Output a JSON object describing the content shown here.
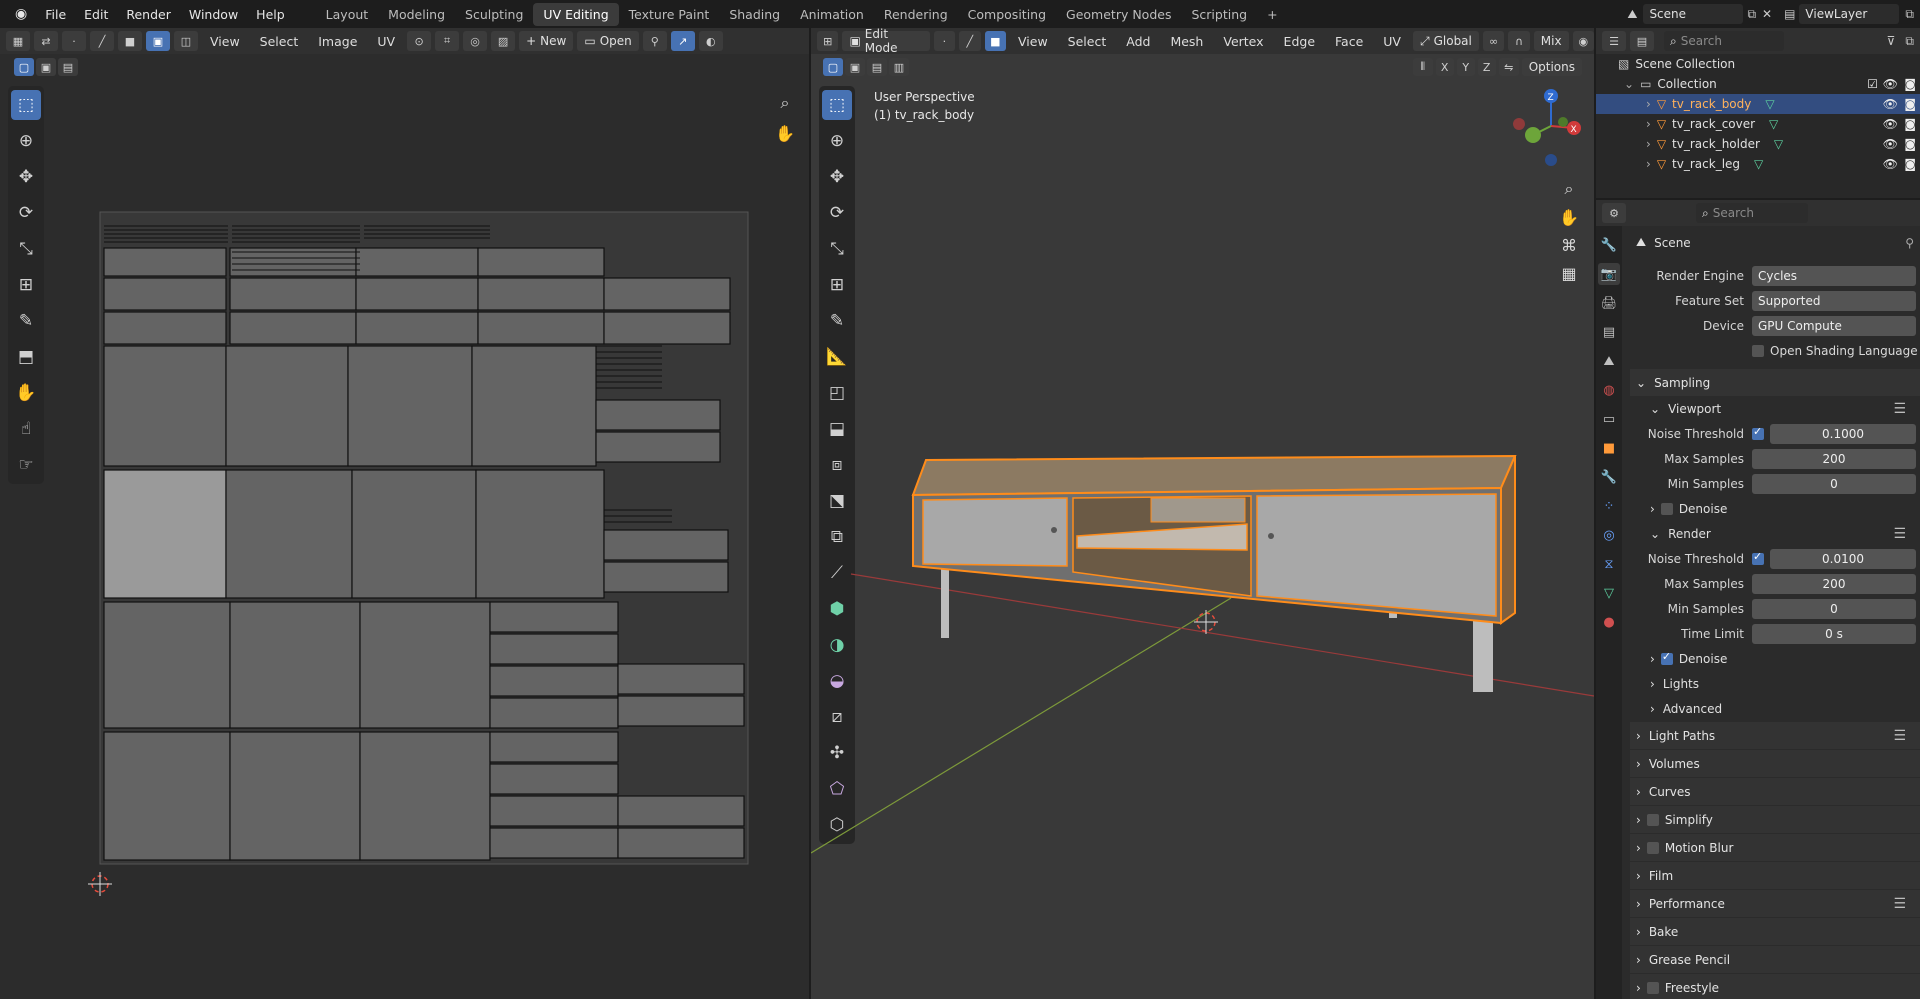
{
  "menu": [
    "File",
    "Edit",
    "Render",
    "Window",
    "Help"
  ],
  "workspaces": [
    "Layout",
    "Modeling",
    "Sculpting",
    "UV Editing",
    "Texture Paint",
    "Shading",
    "Animation",
    "Rendering",
    "Compositing",
    "Geometry Nodes",
    "Scripting"
  ],
  "active_workspace": "UV Editing",
  "scene_name": "Scene",
  "view_layer": "ViewLayer",
  "uv_editor": {
    "menus": [
      "View",
      "Select",
      "Image",
      "UV"
    ],
    "new_label": "New",
    "open_label": "Open"
  },
  "viewport": {
    "mode": "Edit Mode",
    "menus": [
      "View",
      "Select",
      "Add",
      "Mesh",
      "Vertex",
      "Edge",
      "Face",
      "UV"
    ],
    "orientation": "Global",
    "shading_mix": "Mix",
    "options_label": "Options",
    "axes": [
      "X",
      "Y",
      "Z"
    ],
    "perspective": "User Perspective",
    "object_info": "(1) tv_rack_body"
  },
  "outliner": {
    "search_placeholder": "Search",
    "scene_collection": "Scene Collection",
    "collection": "Collection",
    "objects": [
      "tv_rack_body",
      "tv_rack_cover",
      "tv_rack_holder",
      "tv_rack_leg"
    ],
    "selected": "tv_rack_body"
  },
  "properties": {
    "search_placeholder": "Search",
    "context": "Scene",
    "render_engine_label": "Render Engine",
    "render_engine": "Cycles",
    "feature_set_label": "Feature Set",
    "feature_set": "Supported",
    "device_label": "Device",
    "device": "GPU Compute",
    "osl_label": "Open Shading Language",
    "sampling": "Sampling",
    "viewport": "Viewport",
    "noise_threshold_label": "Noise Threshold",
    "viewport_noise": "0.1000",
    "max_samples_label": "Max Samples",
    "viewport_max": "200",
    "min_samples_label": "Min Samples",
    "viewport_min": "0",
    "denoise_label": "Denoise",
    "render": "Render",
    "render_noise": "0.0100",
    "render_max": "200",
    "render_min": "0",
    "time_limit_label": "Time Limit",
    "time_limit": "0 s",
    "lights": "Lights",
    "advanced": "Advanced",
    "panels": [
      "Light Paths",
      "Volumes",
      "Curves",
      "Simplify",
      "Motion Blur",
      "Film",
      "Performance",
      "Bake",
      "Grease Pencil",
      "Freestyle"
    ]
  },
  "colors": {
    "accent": "#4772b3",
    "selection_orange": "#ff8c1a",
    "header": "#303030",
    "background": "#2b2b2b"
  }
}
